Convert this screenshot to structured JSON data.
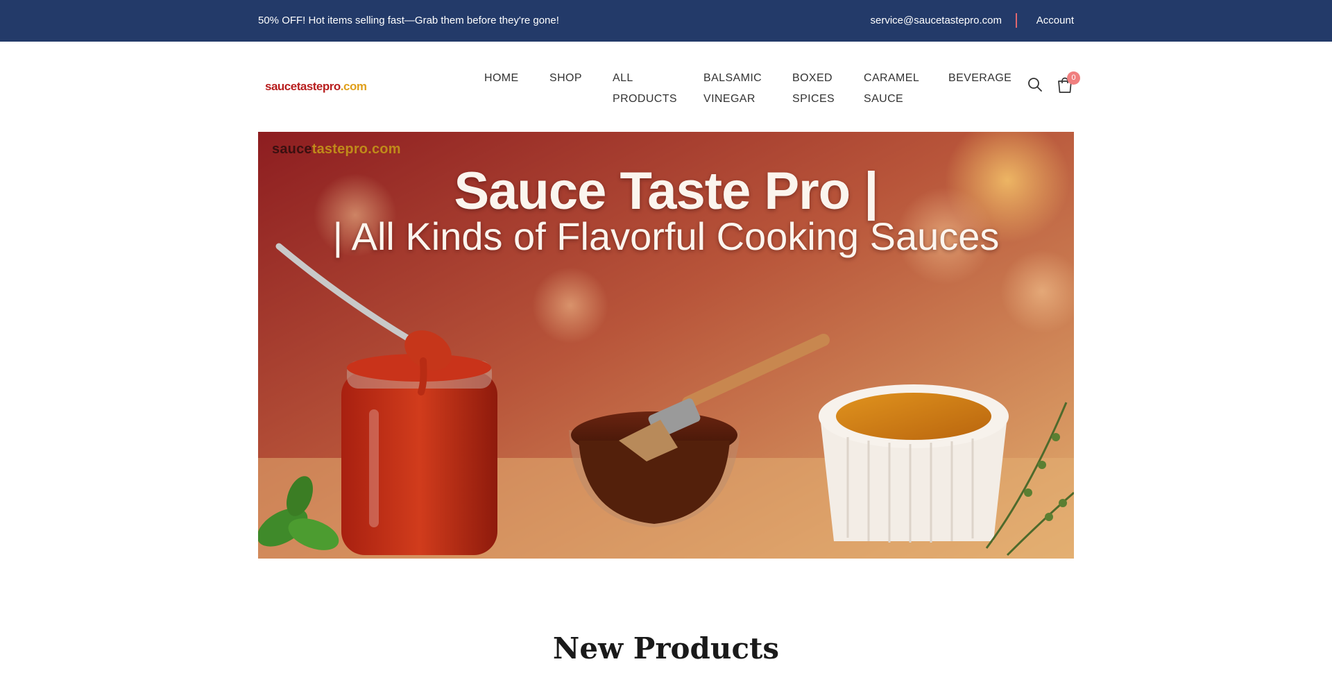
{
  "topbar": {
    "promo": "50% OFF! Hot items selling fast—Grab them before they're gone!",
    "email": "service@saucetastepro.com",
    "account": "Account"
  },
  "header": {
    "logo_part1": "saucetastepro",
    "logo_part2": ".com",
    "nav": {
      "home": "HOME",
      "shop": "SHOP",
      "all_products": [
        "ALL",
        "PRODUCTS"
      ],
      "balsamic_vinegar": [
        "BALSAMIC",
        "VINEGAR"
      ],
      "boxed_spices": [
        "BOXED",
        "SPICES"
      ],
      "caramel_sauce": [
        "CARAMEL",
        "SAUCE"
      ],
      "beverage": "BEVERAGE"
    },
    "cart_count": "0"
  },
  "hero": {
    "watermark_dark": "sauce",
    "watermark_light": "tastepro.com",
    "title": "Sauce Taste Pro |",
    "subtitle": "| All Kinds of Flavorful Cooking Sauces"
  },
  "sections": {
    "new_products_title": "New Products"
  },
  "colors": {
    "topbar_bg": "#233a69",
    "accent": "#f07f7f",
    "logo_red": "#b81f1f",
    "logo_orange": "#e0a01c"
  },
  "icons": {
    "search": "search-icon",
    "cart": "shopping-bag-icon"
  }
}
